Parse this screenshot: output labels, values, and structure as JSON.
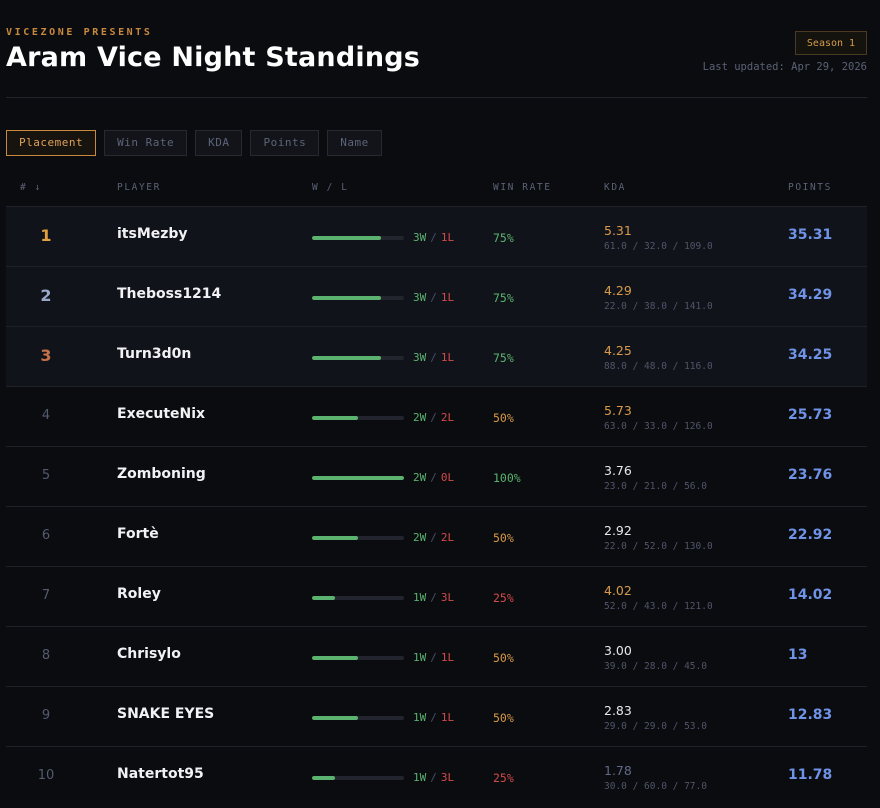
{
  "header": {
    "eyebrow": "VICEZONE PRESENTS",
    "title": "Aram Vice Night Standings",
    "season": "Season 1",
    "updated": "Last updated: Apr 29, 2026"
  },
  "sort_buttons": [
    {
      "label": "Placement",
      "active": true
    },
    {
      "label": "Win Rate",
      "active": false
    },
    {
      "label": "KDA",
      "active": false
    },
    {
      "label": "Points",
      "active": false
    },
    {
      "label": "Name",
      "active": false
    }
  ],
  "columns": {
    "rank": "# ↓",
    "player": "PLAYER",
    "wl": "W / L",
    "winrate": "WIN RATE",
    "kda": "KDA",
    "points": "POINTS"
  },
  "colors": {
    "accent": "#c8883e",
    "win": "#5bb36f",
    "loss": "#d24a4a",
    "points": "#6f93e6",
    "gold": "#e0a040",
    "silver": "#9aa8c8",
    "bronze": "#c4714a",
    "kda_high": "#d89a4a",
    "kda_mid": "#e8e8ec",
    "kda_low": "#5f6a86",
    "wr_high": "#5bb36f",
    "wr_mid": "#d89a4a",
    "wr_low": "#d24a4a"
  },
  "players": [
    {
      "rank": "1",
      "name": "itsMezby",
      "wins": "3W",
      "losses": "1L",
      "winrate": "75%",
      "win_fraction": 0.75,
      "kda": "5.31",
      "kda_detail": "61.0 / 32.0 / 109.0",
      "points": "35.31"
    },
    {
      "rank": "2",
      "name": "Theboss1214",
      "wins": "3W",
      "losses": "1L",
      "winrate": "75%",
      "win_fraction": 0.75,
      "kda": "4.29",
      "kda_detail": "22.0 / 38.0 / 141.0",
      "points": "34.29"
    },
    {
      "rank": "3",
      "name": "Turn3d0n",
      "wins": "3W",
      "losses": "1L",
      "winrate": "75%",
      "win_fraction": 0.75,
      "kda": "4.25",
      "kda_detail": "88.0 / 48.0 / 116.0",
      "points": "34.25"
    },
    {
      "rank": "4",
      "name": "ExecuteNix",
      "wins": "2W",
      "losses": "2L",
      "winrate": "50%",
      "win_fraction": 0.5,
      "kda": "5.73",
      "kda_detail": "63.0 / 33.0 / 126.0",
      "points": "25.73"
    },
    {
      "rank": "5",
      "name": "Zomboning",
      "wins": "2W",
      "losses": "0L",
      "winrate": "100%",
      "win_fraction": 1.0,
      "kda": "3.76",
      "kda_detail": "23.0 / 21.0 / 56.0",
      "points": "23.76"
    },
    {
      "rank": "6",
      "name": "Fortè",
      "wins": "2W",
      "losses": "2L",
      "winrate": "50%",
      "win_fraction": 0.5,
      "kda": "2.92",
      "kda_detail": "22.0 / 52.0 / 130.0",
      "points": "22.92"
    },
    {
      "rank": "7",
      "name": "Roley",
      "wins": "1W",
      "losses": "3L",
      "winrate": "25%",
      "win_fraction": 0.25,
      "kda": "4.02",
      "kda_detail": "52.0 / 43.0 / 121.0",
      "points": "14.02"
    },
    {
      "rank": "8",
      "name": "Chrisylo",
      "wins": "1W",
      "losses": "1L",
      "winrate": "50%",
      "win_fraction": 0.5,
      "kda": "3.00",
      "kda_detail": "39.0 / 28.0 / 45.0",
      "points": "13"
    },
    {
      "rank": "9",
      "name": "SNAKE EYES",
      "wins": "1W",
      "losses": "1L",
      "winrate": "50%",
      "win_fraction": 0.5,
      "kda": "2.83",
      "kda_detail": "29.0 / 29.0 / 53.0",
      "points": "12.83"
    },
    {
      "rank": "10",
      "name": "Natertot95",
      "wins": "1W",
      "losses": "3L",
      "winrate": "25%",
      "win_fraction": 0.25,
      "kda": "1.78",
      "kda_detail": "30.0 / 60.0 / 77.0",
      "points": "11.78"
    }
  ]
}
